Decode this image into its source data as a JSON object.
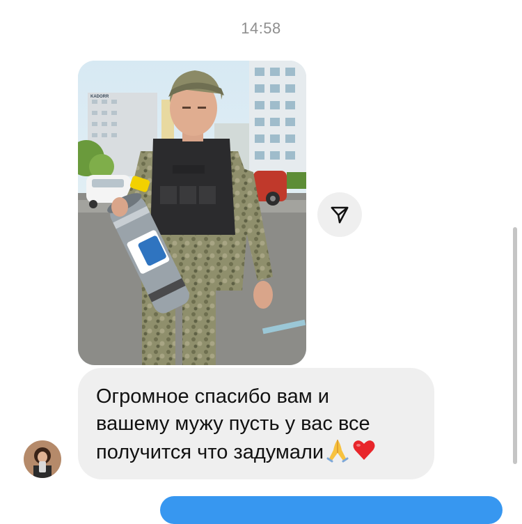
{
  "thread": {
    "timestamp": "14:58"
  },
  "photo_message": {
    "sign_text": "KADORR"
  },
  "text_message": {
    "line1": "Огромное спасибо вам и",
    "line2": "вашему мужу пусть у вас все",
    "line3": "получится что задумали",
    "emojis": [
      "folded-hands",
      "red-heart"
    ]
  },
  "colors": {
    "incoming_bubble": "#efefef",
    "outgoing_bubble": "#3797f0",
    "timestamp": "#8e8e8e",
    "text": "#111111"
  }
}
